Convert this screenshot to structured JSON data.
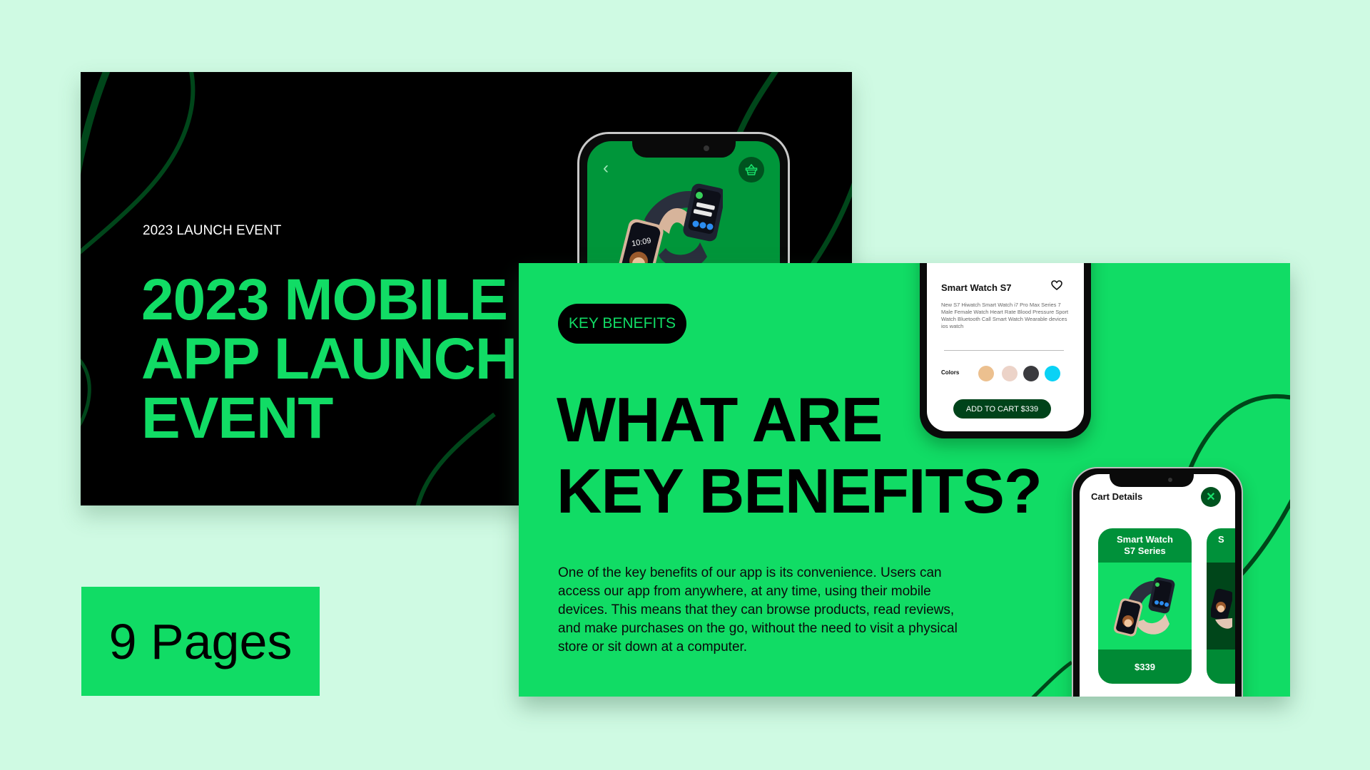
{
  "slide1": {
    "eyebrow": "2023 LAUNCH EVENT",
    "title_lines": [
      "2023 MOBILE",
      "APP LAUNCH",
      "EVENT"
    ],
    "phone": {
      "back_icon": "chevron-left-icon",
      "cart_icon": "basket-icon",
      "watch_time": "10:09"
    }
  },
  "slide2": {
    "pill": "KEY BENEFITS",
    "title_lines": [
      "WHAT ARE",
      "KEY BENEFITS?"
    ],
    "body": "One of the key benefits of our app is its convenience. Users can access our app from anywhere, at any time, using their mobile devices. This means that they can browse products, read reviews, and make purchases on the go, without the need to visit a physical store or sit down at a computer.",
    "product_phone": {
      "title": "Smart Watch S7",
      "favorite_icon": "heart-icon",
      "description": "New S7 Hiwatch Smart Watch i7 Pro Max Series 7 Male Female Watch Heart Rate Blood Pressure Sport Watch Bluetooth Call Smart Watch Wearable devices ios watch",
      "colors_label": "Colors",
      "colors": [
        "#ecc08f",
        "#ecd3c8",
        "#3a3a3e",
        "#0ad2f5"
      ],
      "cart_button": "ADD TO CART $339"
    },
    "cart_phone": {
      "title": "Cart Details",
      "close_icon": "close-icon",
      "cards": [
        {
          "name": "Smart Watch S7 Series",
          "name_line1": "Smart Watch",
          "name_line2": "S7 Series",
          "price": "$339"
        },
        {
          "name_line1": "S",
          "name_line2": "",
          "price": ""
        }
      ]
    }
  },
  "badge": {
    "pages": "9 Pages"
  },
  "colors": {
    "background": "#cffae3",
    "brand_green": "#11dc65",
    "dark_green": "#00461a",
    "black": "#000000"
  }
}
